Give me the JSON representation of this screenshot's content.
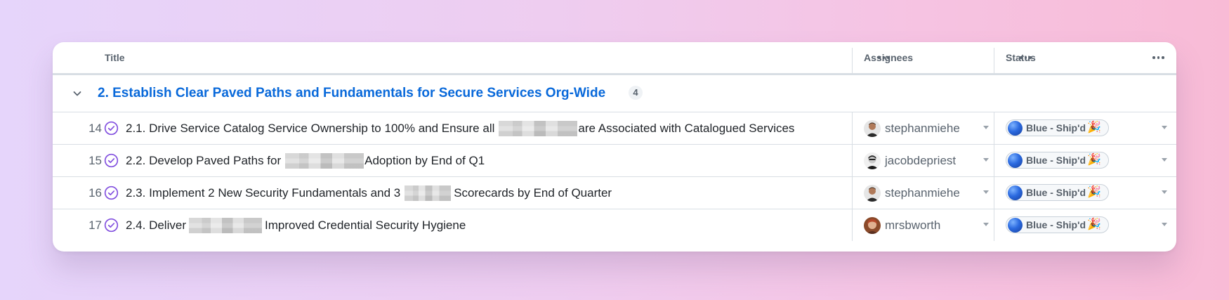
{
  "header": {
    "title_col": "Title",
    "assignees_col": "Assignees",
    "status_col": "Status"
  },
  "group": {
    "title": "2. Establish Clear Paved Paths and Fundamentals for Secure Services Org-Wide",
    "count": "4"
  },
  "rows": [
    {
      "number": "14",
      "title_before": "2.1. Drive Service Catalog Service Ownership to 100% and Ensure all",
      "title_after": "are Associated with Catalogued Services",
      "assignee": "stephanmiehe",
      "status": "Blue - Ship'd",
      "status_emoji": "🎉"
    },
    {
      "number": "15",
      "title_before": "2.2. Develop Paved Paths for",
      "title_after": "Adoption by End of Q1",
      "assignee": "jacobdepriest",
      "status": "Blue - Ship'd",
      "status_emoji": "🎉"
    },
    {
      "number": "16",
      "title_before": "2.3. Implement 2 New Security Fundamentals and 3",
      "title_after": "Scorecards by End of Quarter",
      "assignee": "stephanmiehe",
      "status": "Blue - Ship'd",
      "status_emoji": "🎉"
    },
    {
      "number": "17",
      "title_before": "2.4. Deliver",
      "title_after": "Improved Credential Security Hygiene",
      "assignee": "mrsbworth",
      "status": "Blue - Ship'd",
      "status_emoji": "🎉"
    }
  ],
  "icons": {
    "collapse": "chevron-down-icon",
    "issue_closed": "check-circle-icon",
    "column_menu": "kebab-horizontal-icon",
    "dropdown": "triangle-down-icon"
  },
  "colors": {
    "group_title": "#0969da",
    "closed_icon": "#8250df",
    "status_dot": "#2b6ae0"
  }
}
